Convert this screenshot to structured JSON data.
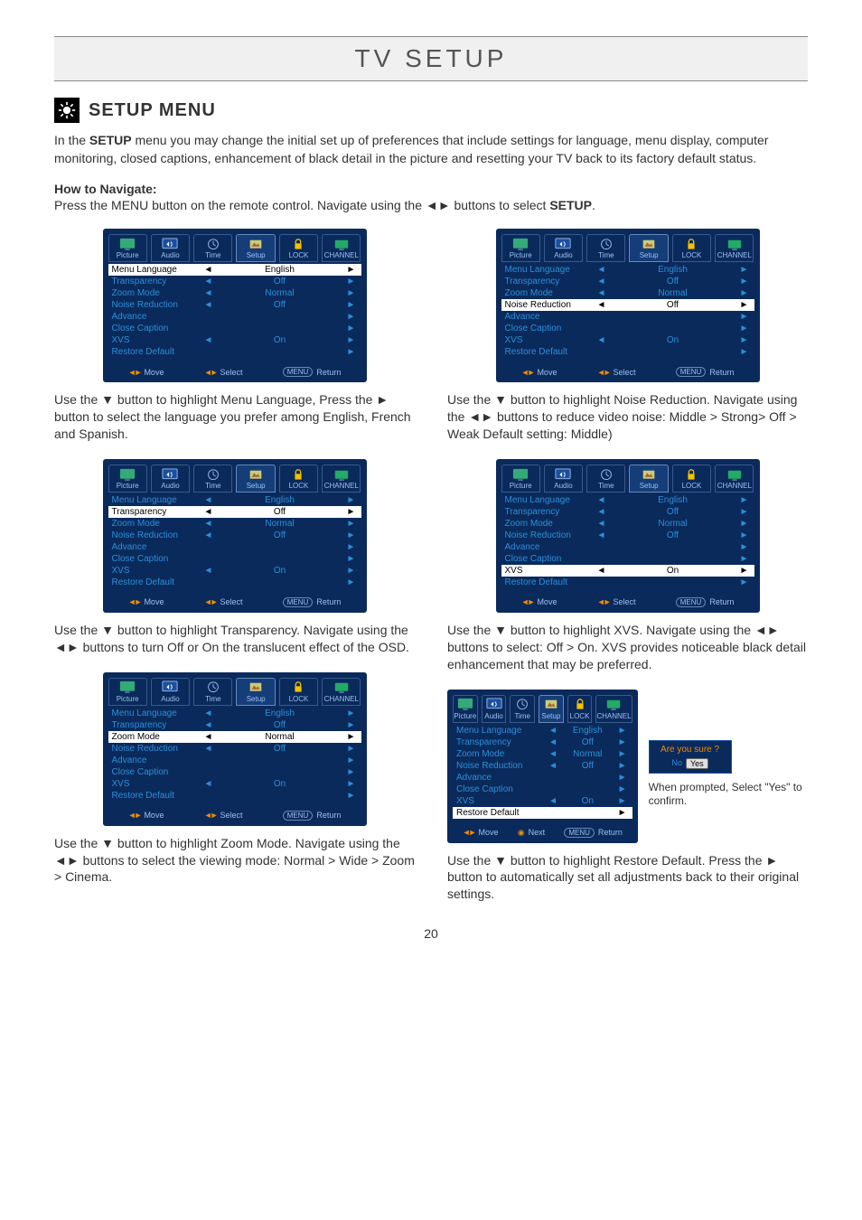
{
  "page_title": "TV SETUP",
  "section_title": "SETUP MENU",
  "intro_html": "In the <b>SETUP</b> menu you may change the initial set up of preferences that include settings for language, menu display, computer monitoring, closed captions, enhancement of black detail in the picture and resetting your TV back to its factory default status.",
  "nav_head": "How to Navigate:",
  "nav_line": "Press the MENU button on the remote control. Navigate using the ◄► buttons to select <b>SETUP</b>.",
  "tabs": [
    {
      "label": "Picture",
      "icon": "picture"
    },
    {
      "label": "Audio",
      "icon": "audio"
    },
    {
      "label": "Time",
      "icon": "time"
    },
    {
      "label": "Setup",
      "icon": "setup"
    },
    {
      "label": "LOCK",
      "icon": "lock"
    },
    {
      "label": "CHANNEL",
      "icon": "channel"
    }
  ],
  "menu_items": [
    {
      "label": "Menu Language",
      "val": "English",
      "arrows": true
    },
    {
      "label": "Transparency",
      "val": "Off",
      "arrows": true
    },
    {
      "label": "Zoom Mode",
      "val": "Normal",
      "arrows": true
    },
    {
      "label": "Noise Reduction",
      "val": "Off",
      "arrows": true
    },
    {
      "label": "Advance",
      "val": "",
      "arrows": false
    },
    {
      "label": "Close Caption",
      "val": "",
      "arrows": false
    },
    {
      "label": "XVS",
      "val": "On",
      "arrows": true
    },
    {
      "label": "Restore Default",
      "val": "",
      "arrows": false
    }
  ],
  "footer": {
    "move": "Move",
    "select": "Select",
    "return": "Return",
    "menu": "MENU",
    "next": "Next"
  },
  "captions": {
    "c1": "Use the ▼ button to highlight Menu Language, Press the ► button to select the language you prefer among English, French and Spanish.",
    "c2": "Use the ▼ button to highlight Transparency. Navigate using the ◄► buttons to turn Off or On the translucent effect of the OSD.",
    "c3": "Use the ▼ button to highlight Zoom Mode. Navigate using the ◄► buttons to select the viewing mode: Normal > Wide > Zoom > Cinema.",
    "c4": "Use the ▼ button to highlight Noise Reduction. Navigate using the ◄► buttons to reduce video noise: Middle > Strong> Off > Weak Default setting: Middle)",
    "c5": "Use the ▼ button to highlight XVS. Navigate using the ◄► buttons to select: Off > On. XVS provides noticeable black detail enhancement that may be preferred.",
    "c6": "Use the ▼ button to highlight Restore Default. Press the ► button to automatically set all adjustments back to their original settings."
  },
  "popup": {
    "q": "Are you sure ?",
    "no": "No",
    "yes": "Yes"
  },
  "popup_note": "When prompted, Select \"Yes\" to confirm.",
  "page_num": "20"
}
